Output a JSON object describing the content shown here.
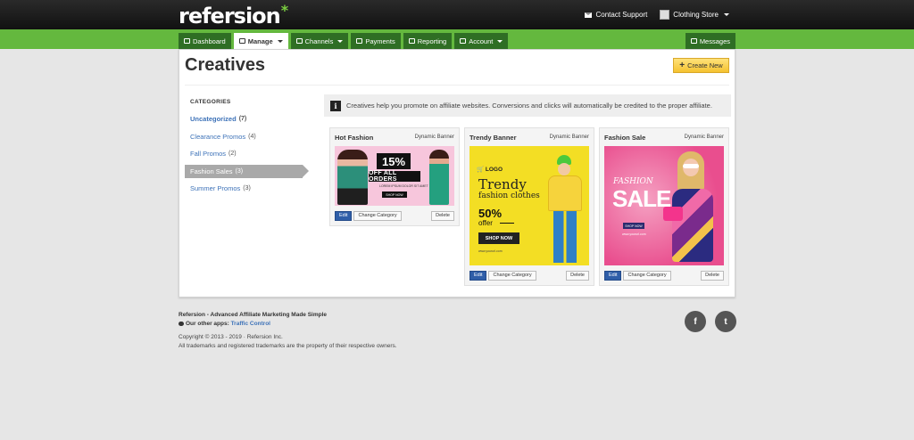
{
  "brand": {
    "logo": "refersion",
    "logo_mark": "*"
  },
  "topbar": {
    "contact": "Contact Support",
    "store": "Clothing Store"
  },
  "nav": {
    "tabs": [
      "Dashboard",
      "Manage",
      "Channels",
      "Payments",
      "Reporting",
      "Account"
    ],
    "active": "Manage",
    "messages": "Messages"
  },
  "page": {
    "title": "Creatives",
    "create_button": "Create New"
  },
  "categories": {
    "heading": "CATEGORIES",
    "items": [
      {
        "label": "Uncategorized",
        "count": "(7)"
      },
      {
        "label": "Clearance Promos",
        "count": "(4)"
      },
      {
        "label": "Fall Promos",
        "count": "(2)"
      },
      {
        "label": "Fashion Sales",
        "count": "(3)"
      },
      {
        "label": "Summer Promos",
        "count": "(3)"
      }
    ],
    "selected": "Fashion Sales"
  },
  "info": {
    "icon": "i",
    "text": "Creatives help you promote on affiliate websites. Conversions and clicks will automatically be credited to the proper affiliate."
  },
  "cards": [
    {
      "title": "Hot Fashion",
      "type": "Dynamic Banner",
      "banner": {
        "percent": "15%",
        "headline": "OFF ALL ORDERS",
        "small": "LOREM IPSUM DOLOR SIT AMET",
        "cta": "SHOP NOW"
      }
    },
    {
      "title": "Trendy Banner",
      "type": "Dynamic Banner",
      "banner": {
        "logo": "LOGO",
        "headline": "Trendy",
        "sub": "fashion clothes",
        "percent": "50%",
        "offer": "offer",
        "cta": "SHOP NOW",
        "url": "www.yoururl.com"
      }
    },
    {
      "title": "Fashion Sale",
      "type": "Dynamic Banner",
      "banner": {
        "top": "FASHION",
        "headline": "SALE",
        "cta": "SHOP NOW",
        "url": "www.yoururl.com"
      }
    }
  ],
  "card_actions": {
    "edit": "Edit",
    "change": "Change Category",
    "delete": "Delete"
  },
  "footer": {
    "tagline_brand": "Refersion",
    "tagline": " - Advanced Affiliate Marketing Made Simple",
    "other_apps_label": "Our other apps: ",
    "other_app": "Traffic Control",
    "copyright": "Copyright © 2013 - 2019 · Refersion Inc.",
    "trademark": "All trademarks and registered trademarks are the property of their respective owners."
  },
  "social": {
    "facebook": "f",
    "twitter": "t"
  },
  "colors": {
    "nav_green": "#64b83e",
    "tab_dark": "#2f6e24",
    "link_blue": "#3d72b8",
    "edit_blue": "#2f5ea8",
    "create_yellow": "#f5c230"
  },
  "icons": [
    "envelope-icon",
    "user-icon",
    "dashboard-icon",
    "edit-icon",
    "rss-icon",
    "money-icon",
    "chart-icon",
    "user-icon",
    "comments-icon",
    "info-icon",
    "plus-icon",
    "facebook-icon",
    "twitter-icon"
  ]
}
